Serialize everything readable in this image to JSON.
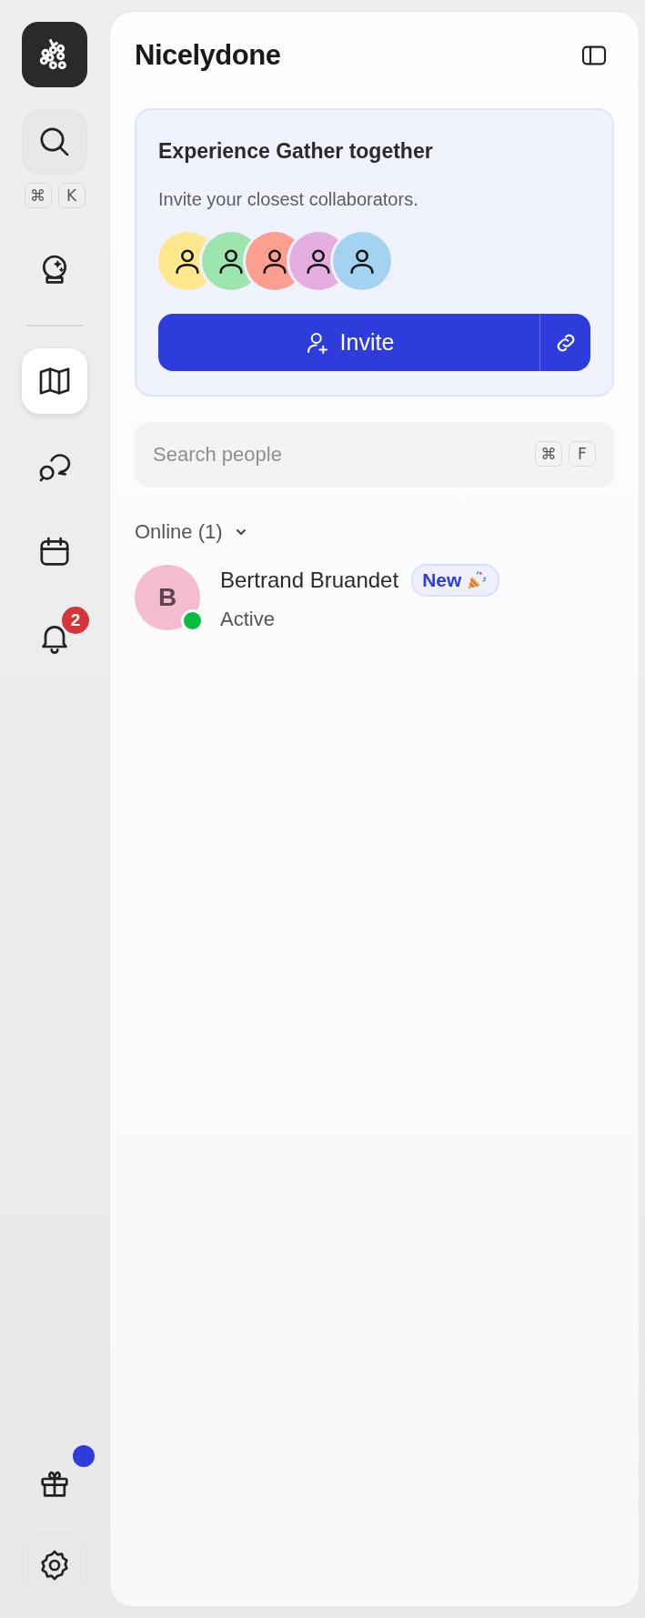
{
  "rail": {
    "search_shortcut": [
      "⌘",
      "K"
    ],
    "nav_items": [
      {
        "selected": true
      },
      {
        "selected": false
      },
      {
        "selected": false
      },
      {
        "selected": false,
        "badge": "2"
      }
    ],
    "gift": {
      "notification_dot": true
    }
  },
  "panel": {
    "title": "Nicelydone",
    "invite_card": {
      "title": "Experience Gather together",
      "subtitle": "Invite your closest collaborators.",
      "avatars": [
        {
          "color": "#fee78c"
        },
        {
          "color": "#9de5ae"
        },
        {
          "color": "#fd9f90"
        },
        {
          "color": "#e4afe0"
        },
        {
          "color": "#a3d3f1"
        }
      ],
      "invite_button": "Invite"
    },
    "search": {
      "placeholder": "Search people",
      "shortcut": [
        "⌘",
        "F"
      ]
    },
    "online_section": {
      "label": "Online (1)",
      "expanded": true,
      "people": [
        {
          "initial": "B",
          "name": "Bertrand Bruandet",
          "badge": "New",
          "online": true,
          "status": "Active"
        }
      ]
    }
  }
}
